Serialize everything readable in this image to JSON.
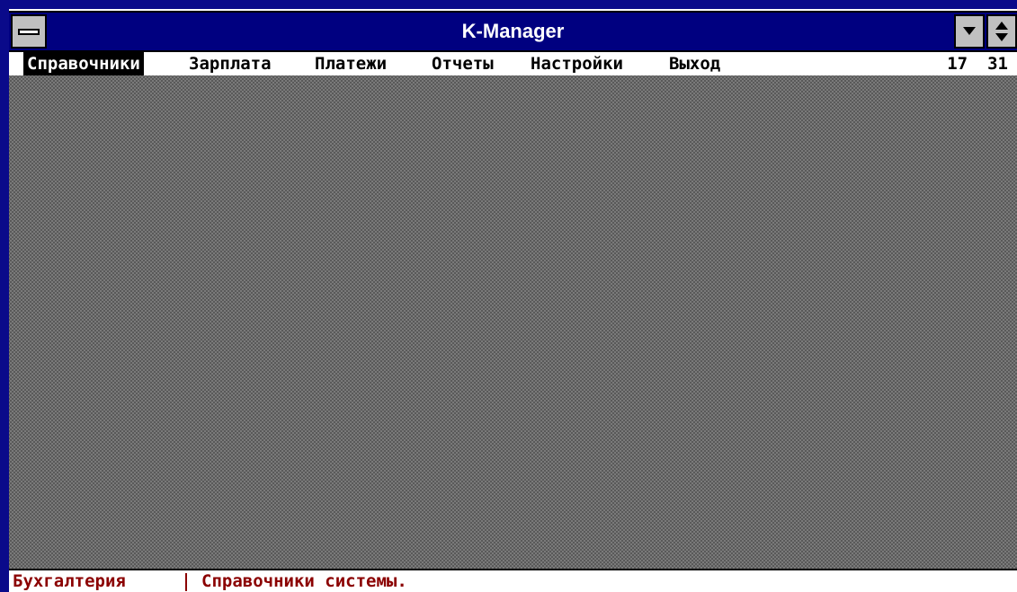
{
  "window": {
    "title": "K-Manager"
  },
  "menu": {
    "items": [
      {
        "label": "Справочники",
        "selected": true
      },
      {
        "label": "Зарплата",
        "selected": false
      },
      {
        "label": "Платежи",
        "selected": false
      },
      {
        "label": "Отчеты",
        "selected": false
      },
      {
        "label": "Настройки",
        "selected": false
      },
      {
        "label": "Выход",
        "selected": false
      }
    ]
  },
  "clock": {
    "hours": "17",
    "minutes": "31"
  },
  "status": {
    "section": "Бухгалтерия",
    "message": "Справочники системы."
  },
  "icons": {
    "system_menu": "system-menu-icon",
    "minimize": "minimize-arrow-icon",
    "restore": "restore-arrows-icon"
  },
  "colors": {
    "titlebar": "#000080",
    "desktop": "#7a7a7a",
    "status_text": "#8b0000",
    "selection": "#000000"
  }
}
